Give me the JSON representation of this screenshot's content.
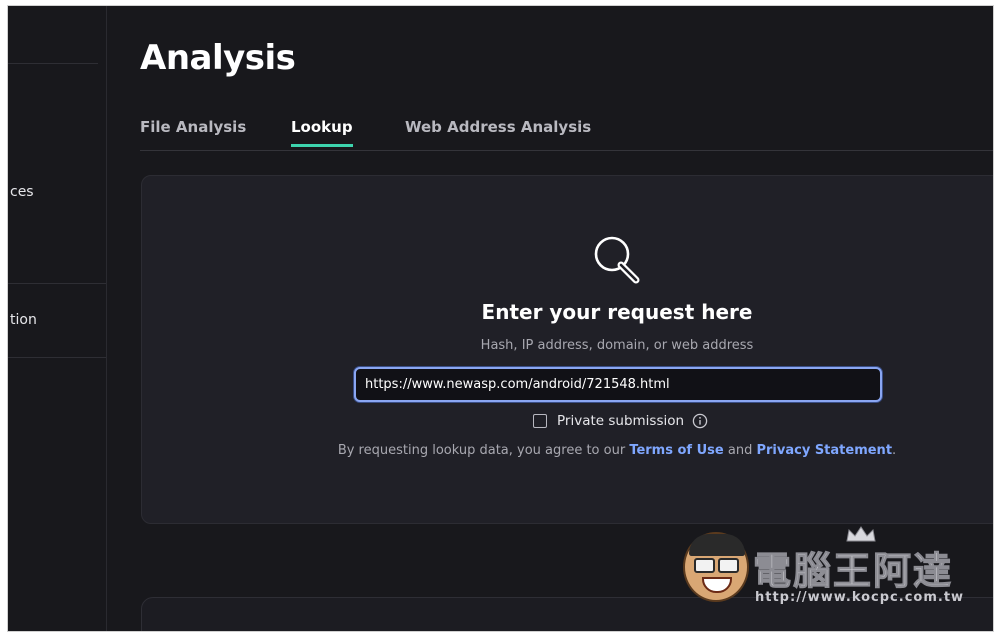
{
  "sidebar": {
    "items": [
      {
        "label": "ces"
      },
      {
        "label": "tion"
      }
    ]
  },
  "page": {
    "title": "Analysis"
  },
  "tabs": [
    {
      "label": "File Analysis",
      "active": false
    },
    {
      "label": "Lookup",
      "active": true
    },
    {
      "label": "Web Address Analysis",
      "active": false
    }
  ],
  "lookup": {
    "icon": "search-icon",
    "title": "Enter your request here",
    "hint": "Hash, IP address, domain, or web address",
    "input_value": "https://www.newasp.com/android/721548.html",
    "private_label": "Private submission",
    "private_checked": false,
    "terms_prefix": "By requesting lookup data, you agree to our",
    "terms_link": "Terms of Use",
    "terms_and": "and",
    "privacy_link": "Privacy Statement",
    "terms_suffix": "."
  },
  "watermark": {
    "text": "電腦王阿達",
    "url": "http://www.kocpc.com.tw"
  },
  "colors": {
    "accent_tab": "#3dd4ae",
    "link": "#7fa7ff",
    "input_border": "#8aa6f2",
    "background": "#18181c",
    "panel": "#202027"
  }
}
